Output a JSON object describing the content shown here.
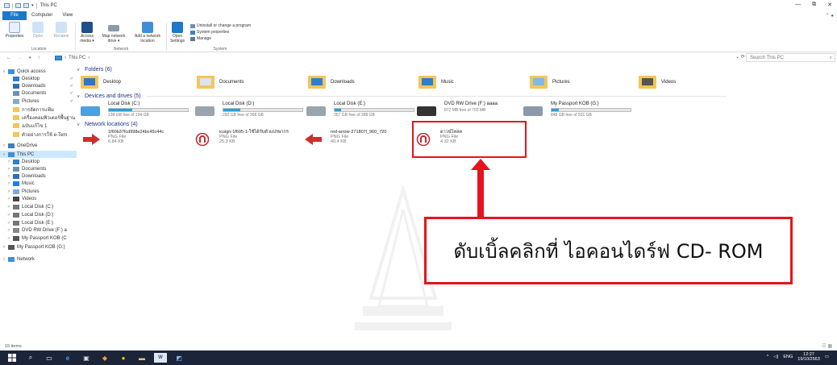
{
  "window": {
    "title": "This PC",
    "controls": {
      "minimize": "—",
      "maximize": "⧉",
      "close": "✕"
    }
  },
  "ribbon": {
    "tabs": [
      "File",
      "Computer",
      "View"
    ],
    "groups": [
      {
        "label": "Location",
        "buttons": [
          "Properties",
          "Open",
          "Rename"
        ]
      },
      {
        "label": "Network",
        "buttons": [
          "Access media ▾",
          "Map network drive ▾",
          "Add a network location"
        ]
      },
      {
        "label": "System",
        "buttons": [
          "Open Settings"
        ],
        "rows": [
          "Uninstall or change a program",
          "System properties",
          "Manage"
        ]
      }
    ]
  },
  "address": {
    "path": [
      "This PC"
    ],
    "search_placeholder": "Search This PC",
    "refresh": "⟳"
  },
  "nav_pane": {
    "items": [
      {
        "label": "Quick access",
        "arrow": "v",
        "pin": false
      },
      {
        "label": "Desktop",
        "arrow": "",
        "pin": true
      },
      {
        "label": "Downloads",
        "arrow": "",
        "pin": true
      },
      {
        "label": "Documents",
        "arrow": "",
        "pin": true
      },
      {
        "label": "Pictures",
        "arrow": "",
        "pin": true
      },
      {
        "label": "การจัดการแฟ้ม",
        "arrow": "",
        "pin": false
      },
      {
        "label": "เครื่องคอมพิวเตอร์พื้นฐาน",
        "arrow": "",
        "pin": false
      },
      {
        "label": "ฉบับแก้ไข 1",
        "arrow": "",
        "pin": false
      },
      {
        "label": "ตัวอย่างการใช้ e-Tem",
        "arrow": "",
        "pin": false
      },
      {
        "label": "OneDrive",
        "arrow": ">",
        "pin": false
      },
      {
        "label": "This PC",
        "arrow": "v",
        "pin": false
      },
      {
        "label": "Desktop",
        "arrow": ">",
        "pin": false
      },
      {
        "label": "Documents",
        "arrow": ">",
        "pin": false
      },
      {
        "label": "Downloads",
        "arrow": ">",
        "pin": false
      },
      {
        "label": "Music",
        "arrow": ">",
        "pin": false
      },
      {
        "label": "Pictures",
        "arrow": ">",
        "pin": false
      },
      {
        "label": "Videos",
        "arrow": ">",
        "pin": false
      },
      {
        "label": "Local Disk (C:)",
        "arrow": ">",
        "pin": false
      },
      {
        "label": "Local Disk (D:)",
        "arrow": ">",
        "pin": false
      },
      {
        "label": "Local Disk (E:)",
        "arrow": ">",
        "pin": false
      },
      {
        "label": "DVD RW Drive (F:) a",
        "arrow": ">",
        "pin": false
      },
      {
        "label": "My Passport KOB (C",
        "arrow": ">",
        "pin": false
      },
      {
        "label": "My Passport KOB (G:)",
        "arrow": ">",
        "pin": false
      },
      {
        "label": "Network",
        "arrow": ">",
        "pin": false
      }
    ]
  },
  "groups": {
    "folders_header": "Folders (6)",
    "devices_header": "Devices and drives (5)",
    "network_header": "Network locations (4)"
  },
  "folders": [
    "Desktop",
    "Documents",
    "Downloads",
    "Music",
    "Pictures",
    "Videos"
  ],
  "drives": [
    {
      "name": "Local Disk (C:)",
      "free": "138 GB free of 194 GB",
      "used_fraction": 0.29
    },
    {
      "name": "Local Disk (D:)",
      "free": "292 GB free of 368 GB",
      "used_fraction": 0.21
    },
    {
      "name": "Local Disk (E:)",
      "free": "357 GB free of 388 GB",
      "used_fraction": 0.08
    },
    {
      "name": "DVD RW Drive (F:) aaaa",
      "free": "872 MB free of 702 MB",
      "used_fraction": 0.0
    },
    {
      "name": "My Passport KOB (G:)",
      "free": "848 GB free of 931 GB",
      "used_fraction": 0.09
    }
  ],
  "network_locations": [
    {
      "name": "1f60b37fcd998e24bc45c44c",
      "type": "PNG File",
      "size": "6.84 KB"
    },
    {
      "name": "icoign-1f605-1-ใช้ได้กับตัวแปรพากร",
      "type": "PNG File",
      "size": "25.3 KB"
    },
    {
      "name": "red-arrow-271807l_960_720",
      "type": "PNG File",
      "size": "40.4 KB"
    },
    {
      "name": "ดาวน์โหลด",
      "type": "PNG File",
      "size": "4.32 KB"
    }
  ],
  "callout": {
    "text": "ดับเบิ้ลคลิกที่ ไอคอนไดร์ฟ CD- ROM"
  },
  "status": {
    "items": "15 items"
  },
  "taskbar": {
    "time": "12:27",
    "date": "19/10/2563",
    "lang": "ENG"
  },
  "colors": {
    "accent": "#1979ca",
    "highlight": "#e5141d",
    "taskbar": "#1b2438"
  }
}
